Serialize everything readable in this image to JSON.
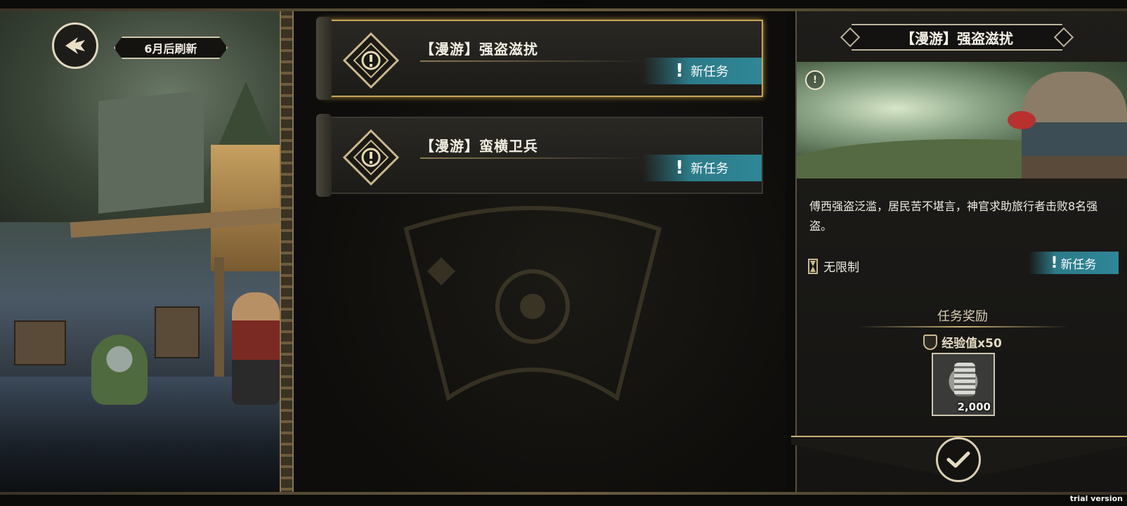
{
  "header": {
    "refresh_label": "6月后刷新"
  },
  "quests": [
    {
      "title": "【漫游】强盗滋扰",
      "badge": "新任务",
      "selected": true
    },
    {
      "title": "【漫游】蛮横卫兵",
      "badge": "新任务",
      "selected": false
    }
  ],
  "detail": {
    "title": "【漫游】强盗滋扰",
    "description": "傅西强盗泛滥，居民苦不堪言，神官求助旅行者击败8名强盗。",
    "time_limit": "无限制",
    "status_badge": "新任务",
    "reward_heading": "任务奖励",
    "reward_exp": "经验值x50",
    "reward_item_qty": "2,000"
  },
  "watermark": "trial version",
  "colors": {
    "accent_gold": "#c9a55a",
    "badge_teal": "#2f8797"
  },
  "icons": {
    "back": "back-arrow-icon",
    "quest": "exclamation-diamond-icon",
    "confirm": "checkmark-icon",
    "time": "hourglass-icon",
    "exp": "shield-icon",
    "item": "coin-stack-icon"
  }
}
